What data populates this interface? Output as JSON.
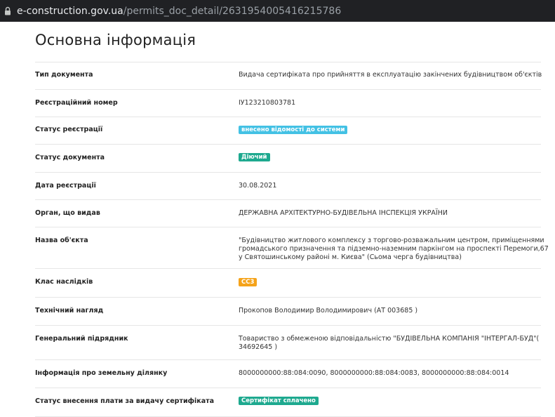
{
  "browser": {
    "url_host": "e-construction.gov.ua",
    "url_path": "/permits_doc_detail/2631954005416215786"
  },
  "page": {
    "title": "Основна інформація"
  },
  "colors": {
    "badge_blue": "#43c1e4",
    "badge_green": "#1ea98f",
    "badge_orange": "#f5a31a"
  },
  "fields": {
    "doc_type": {
      "label": "Тип документа",
      "value": "Видача сертифіката про прийняття в експлуатацію закінчених будівництвом об'єктів"
    },
    "reg_number": {
      "label": "Реєстраційний номер",
      "value": "ІУ123210803781"
    },
    "reg_status": {
      "label": "Статус реєстрації",
      "value": "внесено відомості до системи"
    },
    "doc_status": {
      "label": "Статус документа",
      "value": "Діючий"
    },
    "reg_date": {
      "label": "Дата реєстрації",
      "value": "30.08.2021"
    },
    "issuer": {
      "label": "Орган, що видав",
      "value": "ДЕРЖАВНА АРХІТЕКТУРНО-БУДІВЕЛЬНА ІНСПЕКЦІЯ УКРАЇНИ"
    },
    "object_name": {
      "label": "Назва об'єкта",
      "lines": [
        "\"Будівництво житлового комплексу з торгово-розважальним центром, приміщеннями",
        "громадського призначення та підземно-наземним паркінгом на проспекті Перемоги,67",
        "у Святошинському районі м. Києва\" (Сьома черга будівництва)"
      ]
    },
    "consequence_class": {
      "label": "Клас наслідків",
      "value": "СС3"
    },
    "tech_supervision": {
      "label": "Технічний нагляд",
      "value": "Прокопов Володимир Володимирович (АТ 003685 )"
    },
    "general_contractor": {
      "label": "Генеральний підрядник",
      "lines": [
        "Товариство з обмеженою відповідальністю \"БУДІВЕЛЬНА КОМПАНІЯ \"ІНТЕРГАЛ-БУД\"(",
        "34692645 )"
      ]
    },
    "land_plot": {
      "label": "Інформація про земельну ділянку",
      "value": "8000000000:88:084:0090, 8000000000:88:084:0083, 8000000000:88:084:0014"
    },
    "fee_status": {
      "label": "Статус внесення плати за видачу сертифіката",
      "value": "Сертифікат сплачено"
    }
  }
}
